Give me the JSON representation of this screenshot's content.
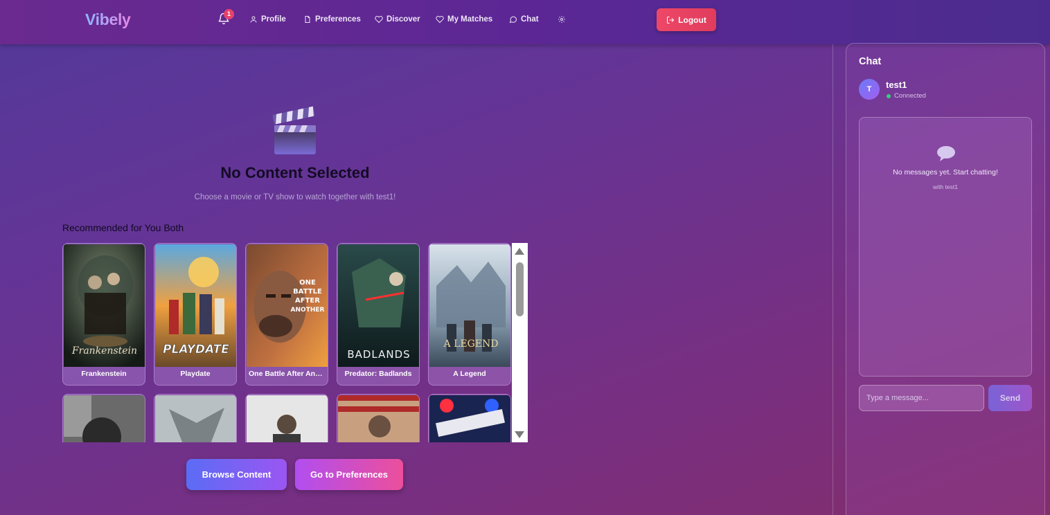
{
  "header": {
    "logo": "Vibely",
    "notifications_count": "1",
    "nav": [
      {
        "label": "Profile",
        "icon": "user-icon"
      },
      {
        "label": "Preferences",
        "icon": "document-icon"
      },
      {
        "label": "Discover",
        "icon": "heart-icon"
      },
      {
        "label": "My Matches",
        "icon": "heart-icon"
      },
      {
        "label": "Chat",
        "icon": "chat-bubble-icon"
      },
      {
        "label": "",
        "icon": "gear-icon"
      }
    ],
    "logout_label": "Logout"
  },
  "main": {
    "title": "No Content Selected",
    "subtitle": "Choose a movie or TV show to watch together with test1!",
    "recommended_title": "Recommended for You Both",
    "cards": [
      {
        "title": "Frankenstein"
      },
      {
        "title": "Playdate"
      },
      {
        "title": "One Battle After Another"
      },
      {
        "title": "Predator: Badlands"
      },
      {
        "title": "A Legend"
      },
      {
        "title": ""
      },
      {
        "title": ""
      },
      {
        "title": ""
      },
      {
        "title": ""
      },
      {
        "title": ""
      }
    ],
    "browse_label": "Browse Content",
    "preferences_label": "Go to Preferences"
  },
  "chat": {
    "title": "Chat",
    "avatar_initial": "T",
    "user": "test1",
    "status": "Connected",
    "empty_text": "No messages yet. Start chatting!",
    "empty_sub": "with test1",
    "input_placeholder": "Type a message...",
    "send_label": "Send"
  },
  "colors": {
    "accent_red": "#e5436c",
    "status_green": "#35d07a",
    "button_blue": "#5b6cf5",
    "button_pink": "#ec4f9b"
  }
}
